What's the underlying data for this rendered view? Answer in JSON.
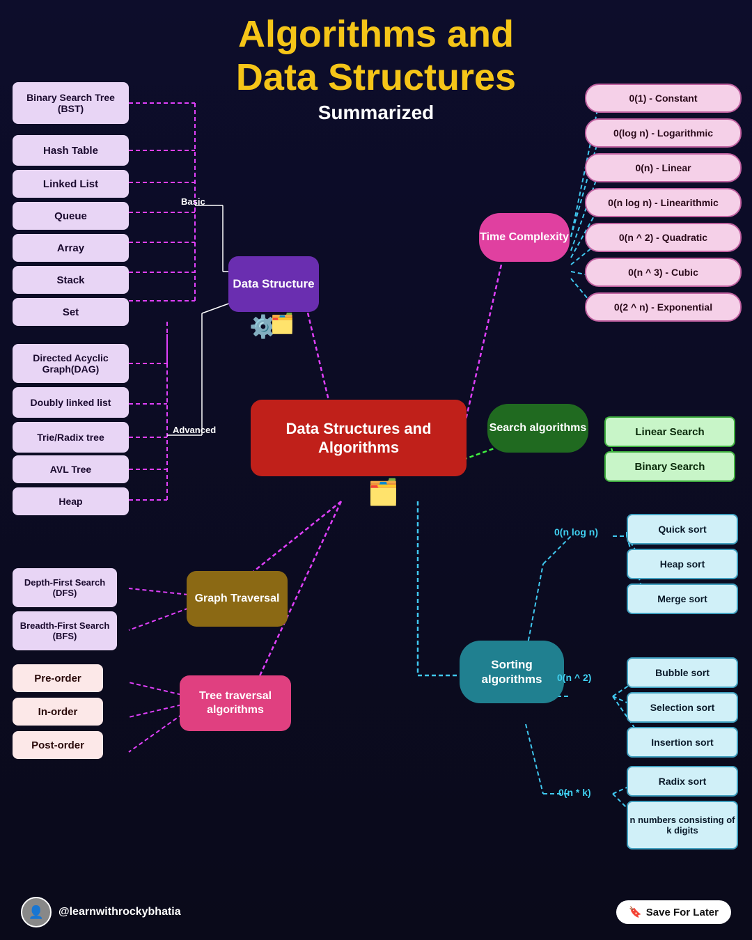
{
  "title": {
    "line1": "Algorithms and",
    "line2": "Data Structures",
    "line3": "Summarized"
  },
  "basic_ds": [
    "Binary Search Tree (BST)",
    "Hash Table",
    "Linked List",
    "Queue",
    "Array",
    "Stack",
    "Set"
  ],
  "advanced_ds": [
    "Directed Acyclic Graph(DAG)",
    "Doubly linked list",
    "Trie/Radix tree",
    "AVL Tree",
    "Heap"
  ],
  "time_complexity": [
    "0(1) - Constant",
    "0(log n) - Logarithmic",
    "0(n) - Linear",
    "0(n log n) - Linearithmic",
    "0(n ^ 2) - Quadratic",
    "0(n ^ 3) - Cubic",
    "0(2 ^ n) - Exponential"
  ],
  "search_algorithms": [
    "Linear Search",
    "Binary Search"
  ],
  "sort_nlogn": [
    "Quick sort",
    "Heap sort",
    "Merge sort"
  ],
  "sort_n2": [
    "Bubble sort",
    "Selection sort",
    "Insertion sort"
  ],
  "sort_nk": [
    "Radix sort",
    "n numbers consisting of k digits"
  ],
  "graph_traversal": [
    "Depth-First Search (DFS)",
    "Breadth-First Search (BFS)"
  ],
  "tree_traversal": [
    "Pre-order",
    "In-order",
    "Post-order"
  ],
  "labels": {
    "data_structure_node": "Data Structure",
    "basic_label": "Basic",
    "advanced_label": "Advanced",
    "time_complexity_node": "Time Complexity",
    "central_node": "Data Structures and Algorithms",
    "search_node": "Search algorithms",
    "sorting_node": "Sorting algorithms",
    "graph_traversal_node": "Graph Traversal",
    "tree_traversal_node": "Tree traversal algorithms",
    "o_nlogn": "0(n log n)",
    "o_n2": "0(n ^ 2)",
    "o_nk": "0(n * k)"
  },
  "footer": {
    "handle": "@learnwithrockybhatia",
    "save": "Save For Later"
  }
}
